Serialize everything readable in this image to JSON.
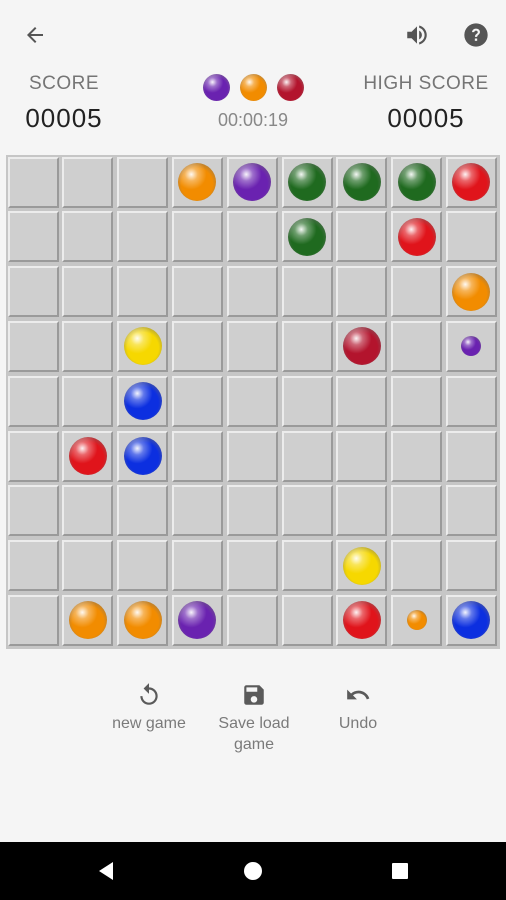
{
  "header": {
    "back_icon": "arrow-back-icon",
    "sound_icon": "volume-icon",
    "help_icon": "help-icon"
  },
  "score": {
    "label": "SCORE",
    "value": "00005"
  },
  "high_score": {
    "label": "HIGH SCORE",
    "value": "00005"
  },
  "next_balls": [
    "purple",
    "orange",
    "crimson"
  ],
  "timer": "00:00:19",
  "colors": {
    "orange": "#f28c00",
    "purple": "#6a22b0",
    "green": "#1f6a1f",
    "red": "#e0141b",
    "crimson": "#b3142d",
    "yellow": "#f6d800",
    "blue": "#0c2fe0"
  },
  "board": {
    "rows": 9,
    "cols": 9,
    "pieces": [
      {
        "row": 0,
        "col": 3,
        "color": "orange",
        "size": "full"
      },
      {
        "row": 0,
        "col": 4,
        "color": "purple",
        "size": "full"
      },
      {
        "row": 0,
        "col": 5,
        "color": "green",
        "size": "full"
      },
      {
        "row": 0,
        "col": 6,
        "color": "green",
        "size": "full"
      },
      {
        "row": 0,
        "col": 7,
        "color": "green",
        "size": "full"
      },
      {
        "row": 0,
        "col": 8,
        "color": "red",
        "size": "full"
      },
      {
        "row": 1,
        "col": 5,
        "color": "green",
        "size": "full"
      },
      {
        "row": 1,
        "col": 7,
        "color": "red",
        "size": "full"
      },
      {
        "row": 2,
        "col": 8,
        "color": "orange",
        "size": "full"
      },
      {
        "row": 3,
        "col": 2,
        "color": "yellow",
        "size": "full"
      },
      {
        "row": 3,
        "col": 6,
        "color": "crimson",
        "size": "full"
      },
      {
        "row": 3,
        "col": 8,
        "color": "purple",
        "size": "small"
      },
      {
        "row": 4,
        "col": 2,
        "color": "blue",
        "size": "full"
      },
      {
        "row": 5,
        "col": 1,
        "color": "red",
        "size": "full"
      },
      {
        "row": 5,
        "col": 2,
        "color": "blue",
        "size": "full"
      },
      {
        "row": 7,
        "col": 6,
        "color": "yellow",
        "size": "full"
      },
      {
        "row": 8,
        "col": 1,
        "color": "orange",
        "size": "full"
      },
      {
        "row": 8,
        "col": 2,
        "color": "orange",
        "size": "full"
      },
      {
        "row": 8,
        "col": 3,
        "color": "purple",
        "size": "full"
      },
      {
        "row": 8,
        "col": 6,
        "color": "red",
        "size": "full"
      },
      {
        "row": 8,
        "col": 7,
        "color": "orange",
        "size": "small"
      },
      {
        "row": 8,
        "col": 8,
        "color": "blue",
        "size": "full"
      }
    ]
  },
  "actions": {
    "new_game": {
      "icon": "refresh-icon",
      "label": "new game"
    },
    "save_load": {
      "icon": "save-icon",
      "label_line1": "Save load",
      "label_line2": "game"
    },
    "undo": {
      "icon": "undo-icon",
      "label": "Undo"
    }
  },
  "nav": {
    "back": "nav-back-icon",
    "home": "nav-home-icon",
    "recents": "nav-recents-icon"
  }
}
